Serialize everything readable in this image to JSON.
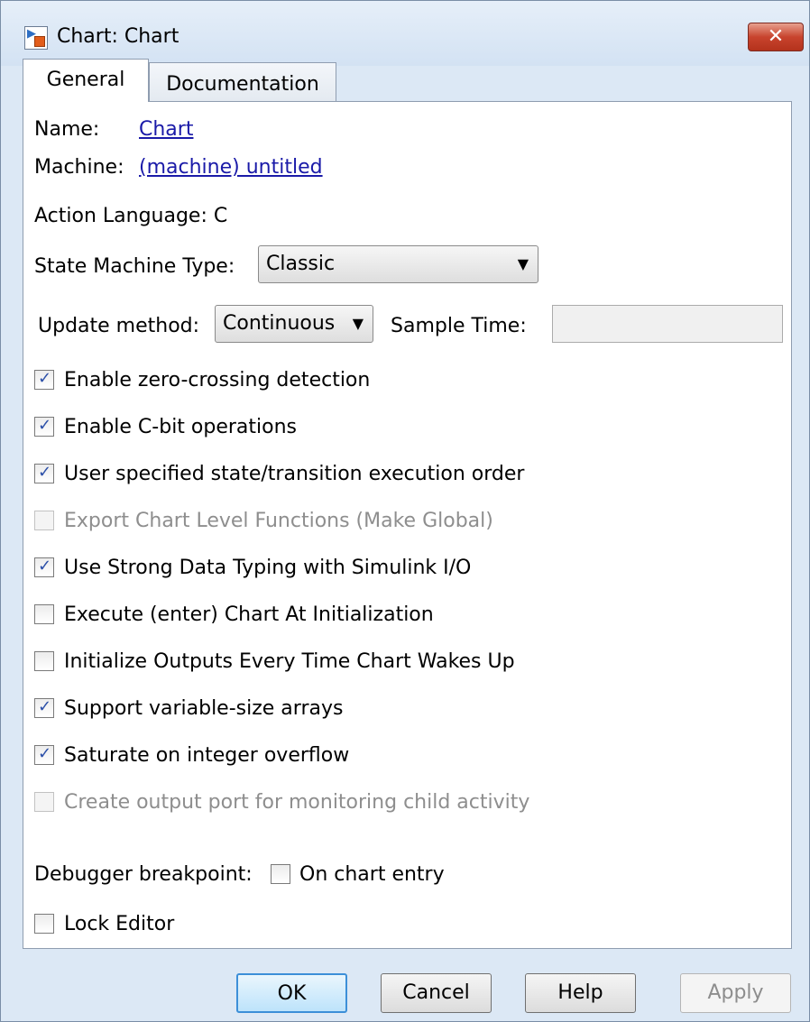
{
  "window": {
    "title": "Chart: Chart",
    "close_label": "✕"
  },
  "tabs": [
    {
      "label": "General",
      "active": true
    },
    {
      "label": "Documentation",
      "active": false
    }
  ],
  "general": {
    "name_label": "Name:",
    "name_value": "Chart",
    "machine_label": "Machine:",
    "machine_value": "(machine) untitled",
    "action_language": "Action Language:  C",
    "state_machine_type_label": "State Machine Type:",
    "state_machine_type_value": "Classic",
    "update_method_label": "Update method:",
    "update_method_value": "Continuous",
    "sample_time_label": "Sample Time:",
    "sample_time_value": "",
    "checkboxes": [
      {
        "label": "Enable zero-crossing detection",
        "checked": true,
        "enabled": true
      },
      {
        "label": "Enable C-bit operations",
        "checked": true,
        "enabled": true
      },
      {
        "label": "User specified state/transition execution order",
        "checked": true,
        "enabled": true
      },
      {
        "label": "Export Chart Level Functions (Make Global)",
        "checked": false,
        "enabled": false
      },
      {
        "label": "Use Strong Data Typing with Simulink I/O",
        "checked": true,
        "enabled": true
      },
      {
        "label": "Execute (enter) Chart At Initialization",
        "checked": false,
        "enabled": true
      },
      {
        "label": "Initialize Outputs Every Time Chart Wakes Up",
        "checked": false,
        "enabled": true
      },
      {
        "label": "Support variable-size arrays",
        "checked": true,
        "enabled": true
      },
      {
        "label": "Saturate on integer overflow",
        "checked": true,
        "enabled": true
      },
      {
        "label": "Create output port for monitoring child activity",
        "checked": false,
        "enabled": false
      }
    ],
    "debugger_label": "Debugger breakpoint:",
    "debugger_checkbox_label": "On chart entry",
    "debugger_checked": false,
    "lock_editor_label": "Lock Editor",
    "lock_editor_checked": false
  },
  "buttons": {
    "ok": "OK",
    "cancel": "Cancel",
    "help": "Help",
    "apply": "Apply"
  },
  "colors": {
    "link": "#1a1aa8",
    "check": "#2b4fa8",
    "default_button": "#3c8fd8"
  }
}
